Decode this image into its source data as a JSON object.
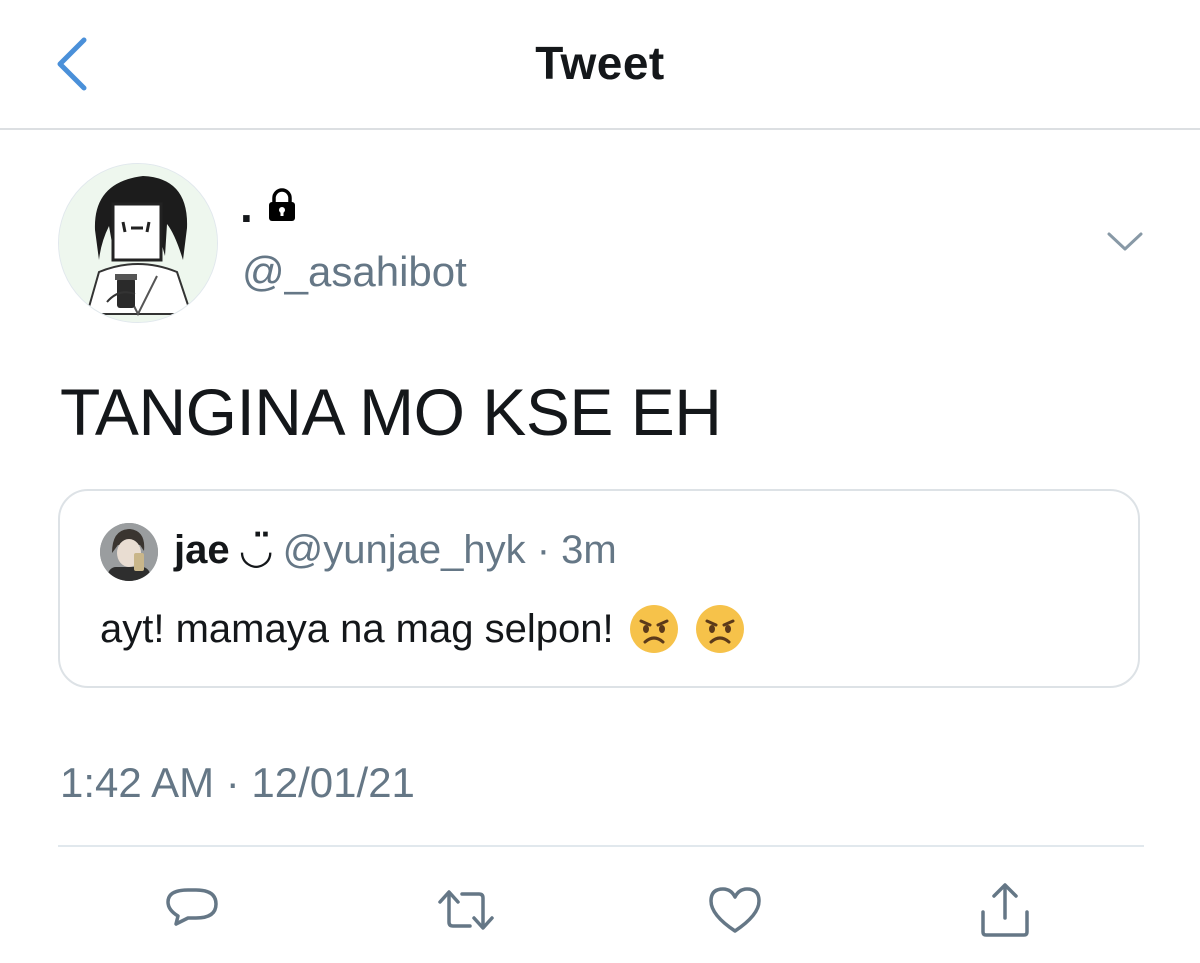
{
  "nav": {
    "title": "Tweet"
  },
  "tweet": {
    "display_name": ".",
    "handle": "@_asahibot",
    "text": "TANGINA MO KSE EH",
    "timestamp": "1:42 AM · 12/01/21"
  },
  "quote": {
    "name": "jae ◡̈",
    "handle": "@yunjae_hyk",
    "separator": "·",
    "time": "3m",
    "text": "ayt! mamaya na mag selpon!"
  },
  "icons": {
    "back": "chevron-left-icon",
    "lock": "lock-icon",
    "caret": "chevron-down-icon",
    "reply": "reply-icon",
    "retweet": "retweet-icon",
    "like": "heart-icon",
    "share": "share-icon",
    "emoji": "angry-face-emoji"
  },
  "colors": {
    "accent": "#4a90d9",
    "secondary_text": "#657786",
    "divider": "#e1e8ed"
  }
}
